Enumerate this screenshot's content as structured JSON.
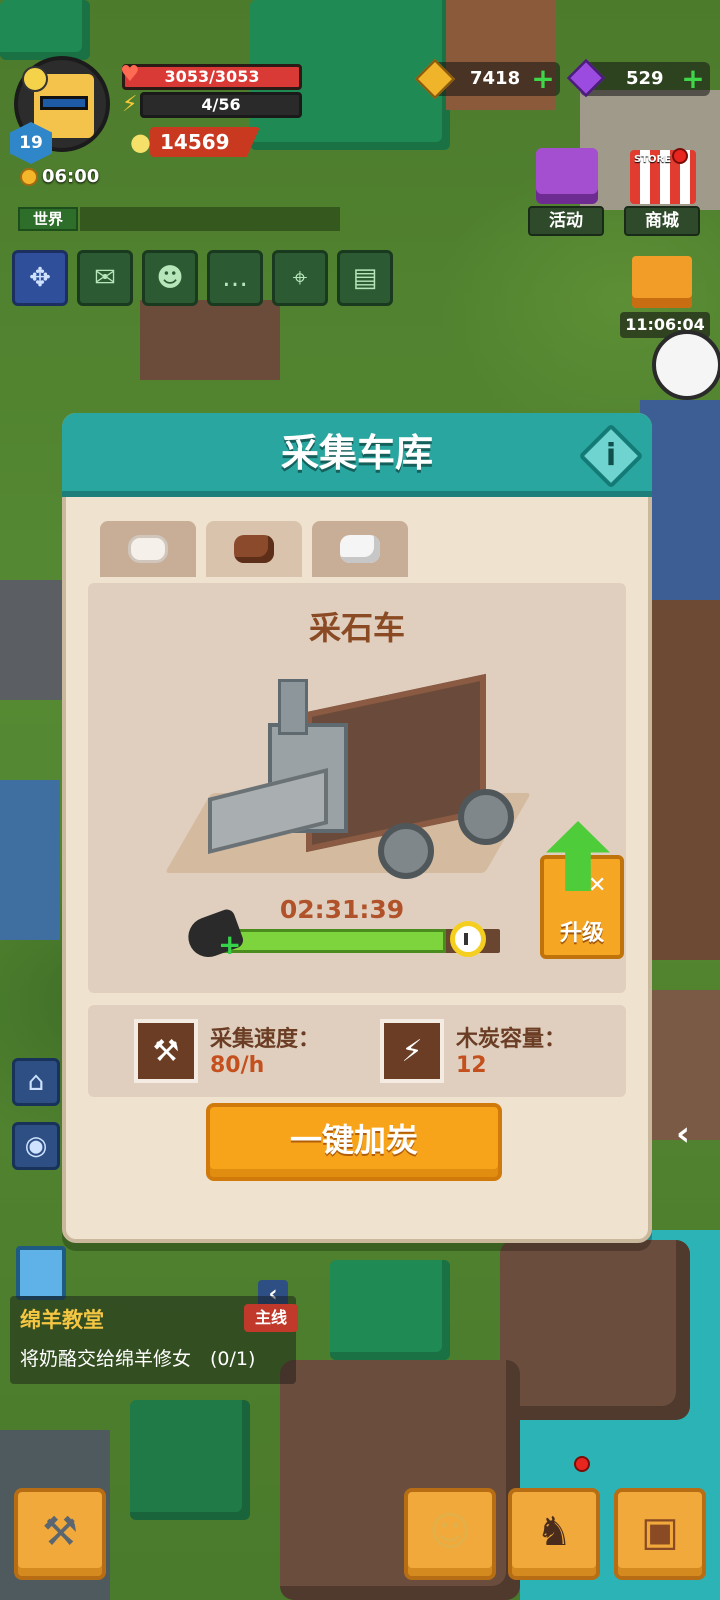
{
  "player": {
    "level": "19",
    "hp": "3053/3053",
    "energy": "4/56",
    "experience": "14569",
    "time": "06:00"
  },
  "world_tag": "世界",
  "currency": {
    "gold": "7418",
    "gems": "529"
  },
  "top_right": {
    "event_label": "活动",
    "store_label": "商城",
    "store_sign": "STORE",
    "gift_timer": "11:06:04"
  },
  "dialog": {
    "title": "采集车库",
    "tabs": [
      {
        "icon": "log-icon"
      },
      {
        "icon": "ore-icon"
      },
      {
        "icon": "stone-icon"
      }
    ],
    "machine_name": "采石车",
    "timer": "02:31:39",
    "progress": 0.82,
    "upgrade_label": "升级",
    "stats": {
      "speed_label": "采集速度：",
      "speed_value": "80/h",
      "capacity_label": "木炭容量：",
      "capacity_value": "12"
    },
    "action_label": "一键加炭"
  },
  "quest": {
    "title": "绵羊教堂",
    "tag": "主线",
    "description": "将奶酪交给绵羊修女　(0/1)"
  },
  "colors": {
    "header_teal": "#2aa6a1",
    "action_orange": "#f8a41b",
    "progress_green": "#7ed43c",
    "dialog_bg": "#efe3cf"
  }
}
